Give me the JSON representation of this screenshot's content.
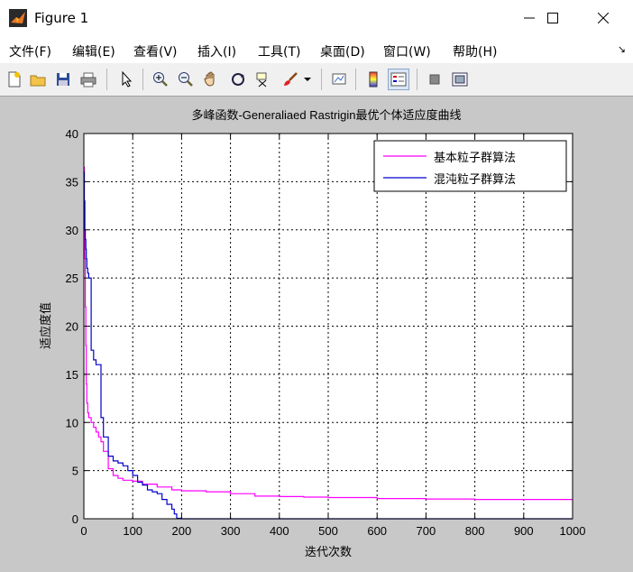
{
  "window": {
    "title": "Figure 1",
    "minimize_glyph": "—",
    "maximize_glyph": "☐",
    "close_glyph": "✕"
  },
  "menu": {
    "items": [
      {
        "label": "文件(F)"
      },
      {
        "label": "编辑(E)"
      },
      {
        "label": "查看(V)"
      },
      {
        "label": "插入(I)"
      },
      {
        "label": "工具(T)"
      },
      {
        "label": "桌面(D)"
      },
      {
        "label": "窗口(W)"
      },
      {
        "label": "帮助(H)"
      }
    ],
    "overflow_glyph": "↘"
  },
  "toolbar": {
    "icons": [
      "new-figure-icon",
      "open-file-icon",
      "save-icon",
      "print-icon",
      "select-arrow-icon",
      "zoom-in-icon",
      "zoom-out-icon",
      "pan-hand-icon",
      "rotate-3d-icon",
      "data-cursor-icon",
      "brush-icon",
      "brush-dropdown-icon",
      "link-plot-icon",
      "colorbar-icon",
      "legend-icon",
      "hide-plot-tools-icon",
      "show-plot-tools-icon"
    ]
  },
  "chart_data": {
    "type": "line",
    "title": "多峰函数-Generaliaed Rastrigin最优个体适应度曲线",
    "xlabel": "迭代次数",
    "ylabel": "适应度值",
    "xlim": [
      0,
      1000
    ],
    "ylim": [
      0,
      40
    ],
    "xticks": [
      0,
      100,
      200,
      300,
      400,
      500,
      600,
      700,
      800,
      900,
      1000
    ],
    "yticks": [
      0,
      5,
      10,
      15,
      20,
      25,
      30,
      35,
      40
    ],
    "grid": true,
    "grid_style": "dotted",
    "legend_position": "top-right",
    "series": [
      {
        "name": "基本粒子群算法",
        "color": "#ff00ff",
        "x": [
          0,
          1,
          2,
          3,
          4,
          5,
          6,
          8,
          10,
          15,
          20,
          25,
          30,
          35,
          40,
          50,
          60,
          70,
          80,
          100,
          120,
          150,
          180,
          200,
          250,
          300,
          350,
          400,
          450,
          500,
          600,
          700,
          800,
          900,
          1000
        ],
        "y": [
          36.5,
          30,
          27,
          22,
          18,
          14,
          12,
          11,
          10.5,
          10,
          9.5,
          9,
          8.5,
          8,
          7,
          5.2,
          4.5,
          4.2,
          4.0,
          3.9,
          3.6,
          3.3,
          3.0,
          2.9,
          2.8,
          2.6,
          2.35,
          2.3,
          2.25,
          2.2,
          2.1,
          2.05,
          2.0,
          2.0,
          2.0
        ]
      },
      {
        "name": "混沌粒子群算法",
        "color": "#0000cc",
        "x": [
          0,
          1,
          2,
          3,
          4,
          5,
          6,
          8,
          10,
          15,
          20,
          25,
          30,
          35,
          40,
          50,
          60,
          70,
          80,
          90,
          100,
          110,
          120,
          130,
          140,
          150,
          160,
          170,
          180,
          185,
          190,
          200,
          1000
        ],
        "y": [
          36,
          33,
          30,
          29,
          28,
          27,
          26,
          25.5,
          25,
          17.5,
          16.5,
          16,
          16,
          10.5,
          8.5,
          6.5,
          6,
          5.8,
          5.5,
          5.0,
          4.5,
          3.8,
          3.5,
          3.0,
          2.8,
          2.6,
          2.0,
          1.5,
          1.0,
          0.5,
          0.05,
          0,
          0
        ]
      }
    ]
  }
}
